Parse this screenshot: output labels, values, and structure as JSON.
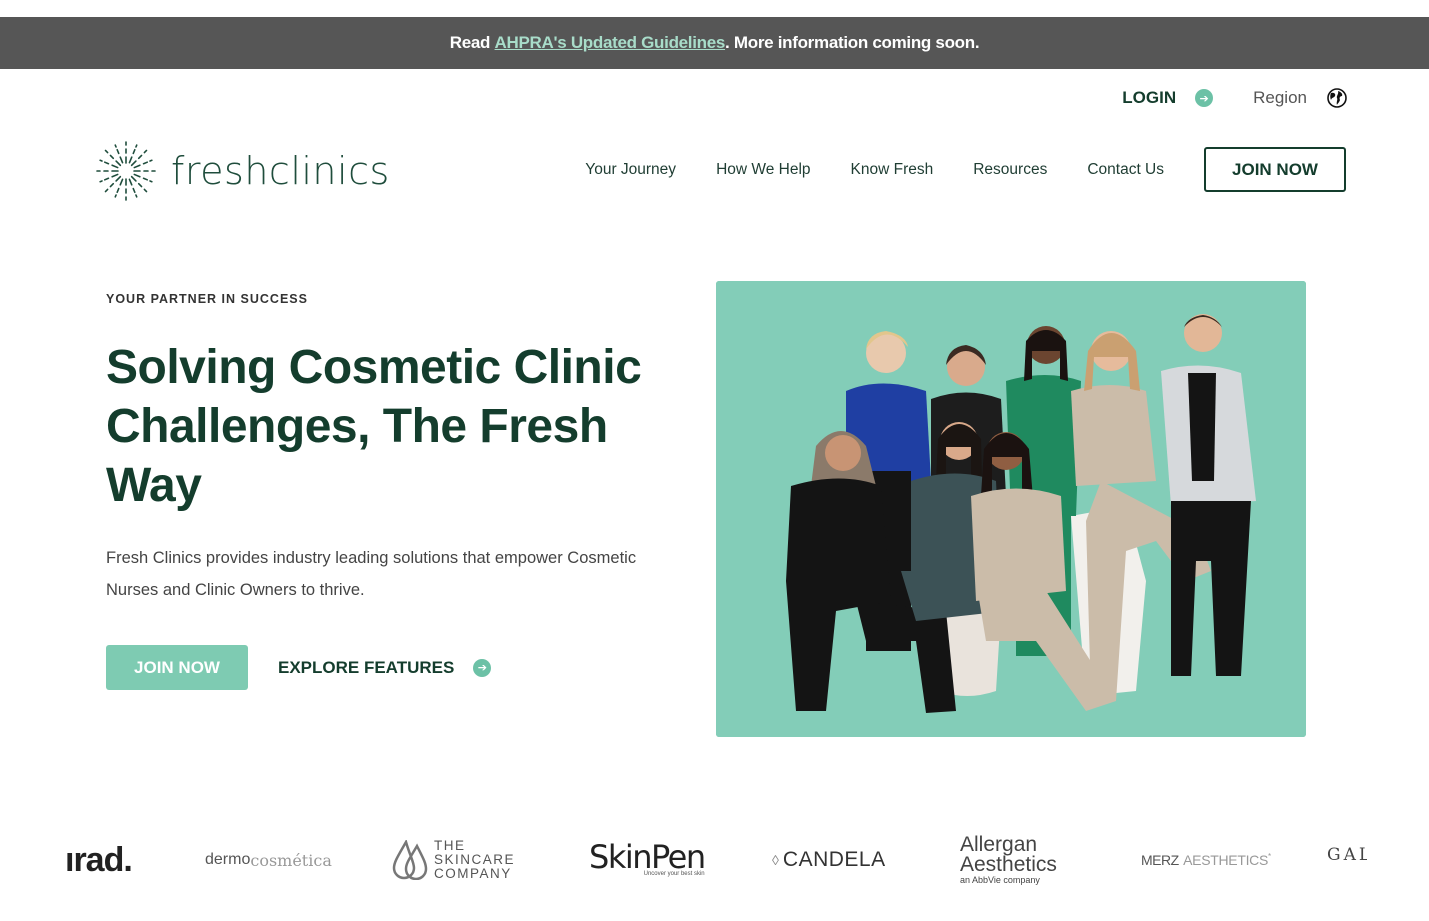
{
  "announcement": {
    "prefix": "Read",
    "link": "AHPRA's Updated Guidelines",
    "suffix": ". More information coming soon."
  },
  "utility": {
    "login": "LOGIN",
    "region": "Region"
  },
  "brand": {
    "logo_text": "freshclinics"
  },
  "nav": {
    "items": [
      "Your Journey",
      "How We Help",
      "Know Fresh",
      "Resources",
      "Contact Us"
    ],
    "join": "JOIN NOW"
  },
  "hero": {
    "eyebrow": "YOUR PARTNER IN SUCCESS",
    "headline": "Solving Cosmetic Clinic Challenges, The Fresh Way",
    "lead": "Fresh Clinics provides industry leading solutions that empower Cosmetic Nurses and Clinic Owners to thrive.",
    "join": "JOIN NOW",
    "explore": "EXPLORE FEATURES"
  },
  "partners": {
    "irad": "ırad.",
    "dermo": "dermo",
    "dermo2": "cosmética",
    "skincare1": "THE",
    "skincare2": "SKINCARE",
    "skincare3": "COMPANY",
    "skinpen": "SkinPen",
    "skinpen_tag": "Uncover your best skin",
    "candela": "CANDELA",
    "allergan1": "Allergan",
    "allergan2": "Aesthetics",
    "allergan3": "an AbbVie company",
    "merz1": "MERZ",
    "merz2": "AESTHETICS",
    "gal": "GAL"
  },
  "colors": {
    "primary_dark": "#143d2d",
    "accent_mint": "#7ecbb2",
    "banner_gray": "#565656"
  }
}
